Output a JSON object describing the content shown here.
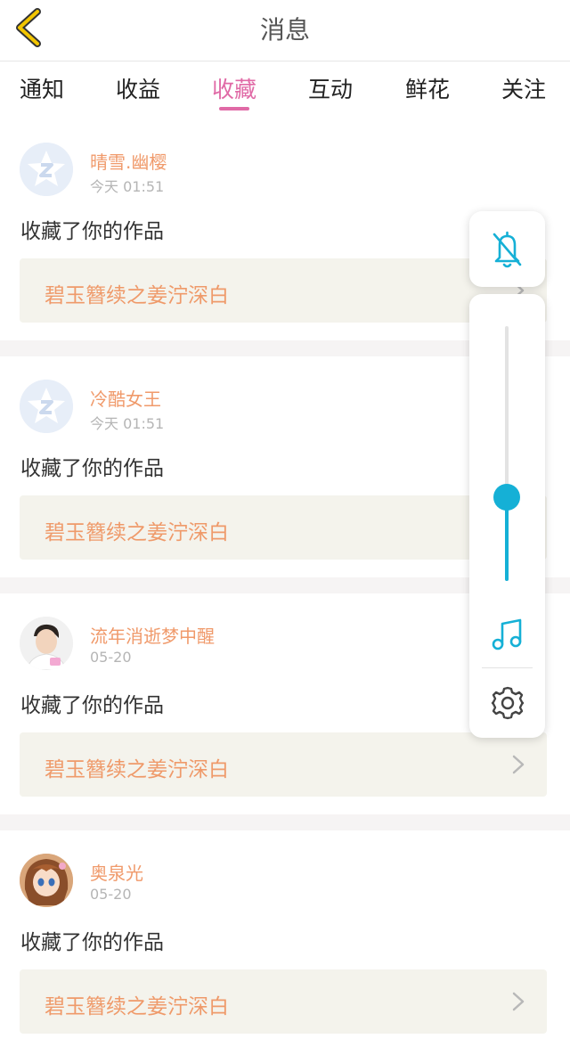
{
  "header": {
    "title": "消息",
    "back_icon": "chevron-left-icon"
  },
  "tabs": [
    {
      "label": "通知",
      "active": false
    },
    {
      "label": "收益",
      "active": false
    },
    {
      "label": "收藏",
      "active": true
    },
    {
      "label": "互动",
      "active": false
    },
    {
      "label": "鲜花",
      "active": false
    },
    {
      "label": "关注",
      "active": false
    }
  ],
  "messages": [
    {
      "name": "晴雪.幽樱",
      "time": "今天 01:51",
      "action": "收藏了你的作品",
      "work": "碧玉簪续之姜泞深白",
      "avatar": "default-avatar"
    },
    {
      "name": "冷酷女王",
      "time": "今天 01:51",
      "action": "收藏了你的作品",
      "work": "碧玉簪续之姜泞深白",
      "avatar": "default-avatar"
    },
    {
      "name": "流年消逝梦中醒",
      "time": "05-20",
      "action": "收藏了你的作品",
      "work": "碧玉簪续之姜泞深白",
      "avatar": "photo-avatar"
    },
    {
      "name": "奥泉光",
      "time": "05-20",
      "action": "收藏了你的作品",
      "work": "碧玉簪续之姜泞深白",
      "avatar": "anime-avatar"
    }
  ],
  "volume_panel": {
    "level": 0.33,
    "mute_icon": "bell-off-icon",
    "music_icon": "music-note-icon",
    "settings_icon": "gear-icon"
  },
  "colors": {
    "accent": "#e06aa6",
    "name": "#f09a6b",
    "volume": "#15b0d6"
  }
}
